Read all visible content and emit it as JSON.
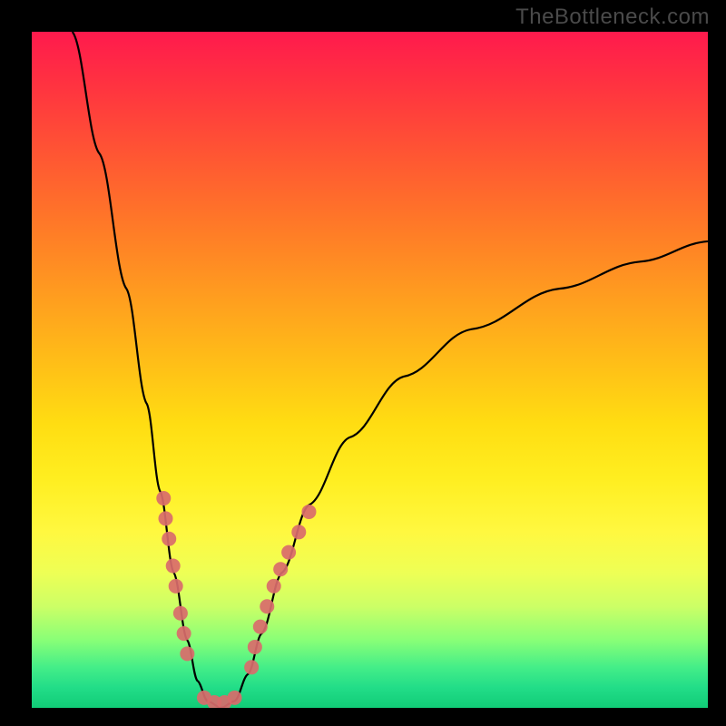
{
  "watermark": "TheBottleneck.com",
  "chart_data": {
    "type": "line",
    "title": "",
    "xlabel": "",
    "ylabel": "",
    "xlim": [
      0,
      100
    ],
    "ylim": [
      0,
      100
    ],
    "curve": {
      "name": "bottleneck-curve",
      "points": [
        {
          "x": 6,
          "y": 100
        },
        {
          "x": 10,
          "y": 82
        },
        {
          "x": 14,
          "y": 62
        },
        {
          "x": 17,
          "y": 45
        },
        {
          "x": 19,
          "y": 32
        },
        {
          "x": 21,
          "y": 20
        },
        {
          "x": 23,
          "y": 10
        },
        {
          "x": 24.5,
          "y": 4
        },
        {
          "x": 26,
          "y": 1
        },
        {
          "x": 28,
          "y": 0
        },
        {
          "x": 30,
          "y": 1
        },
        {
          "x": 32,
          "y": 5
        },
        {
          "x": 34,
          "y": 11
        },
        {
          "x": 37,
          "y": 20
        },
        {
          "x": 41,
          "y": 30
        },
        {
          "x": 47,
          "y": 40
        },
        {
          "x": 55,
          "y": 49
        },
        {
          "x": 65,
          "y": 56
        },
        {
          "x": 78,
          "y": 62
        },
        {
          "x": 90,
          "y": 66
        },
        {
          "x": 100,
          "y": 69
        }
      ]
    },
    "markers": {
      "name": "data-points",
      "color": "#d96b6b",
      "points": [
        {
          "x": 19.5,
          "y": 31
        },
        {
          "x": 19.8,
          "y": 28
        },
        {
          "x": 20.3,
          "y": 25
        },
        {
          "x": 20.9,
          "y": 21
        },
        {
          "x": 21.3,
          "y": 18
        },
        {
          "x": 22.0,
          "y": 14
        },
        {
          "x": 22.5,
          "y": 11
        },
        {
          "x": 23.0,
          "y": 8
        },
        {
          "x": 25.5,
          "y": 1.5
        },
        {
          "x": 27.0,
          "y": 0.8
        },
        {
          "x": 28.5,
          "y": 0.8
        },
        {
          "x": 30.0,
          "y": 1.5
        },
        {
          "x": 32.5,
          "y": 6
        },
        {
          "x": 33.0,
          "y": 9
        },
        {
          "x": 33.8,
          "y": 12
        },
        {
          "x": 34.8,
          "y": 15
        },
        {
          "x": 35.8,
          "y": 18
        },
        {
          "x": 36.8,
          "y": 20.5
        },
        {
          "x": 38.0,
          "y": 23
        },
        {
          "x": 39.5,
          "y": 26
        },
        {
          "x": 41.0,
          "y": 29
        }
      ]
    }
  }
}
